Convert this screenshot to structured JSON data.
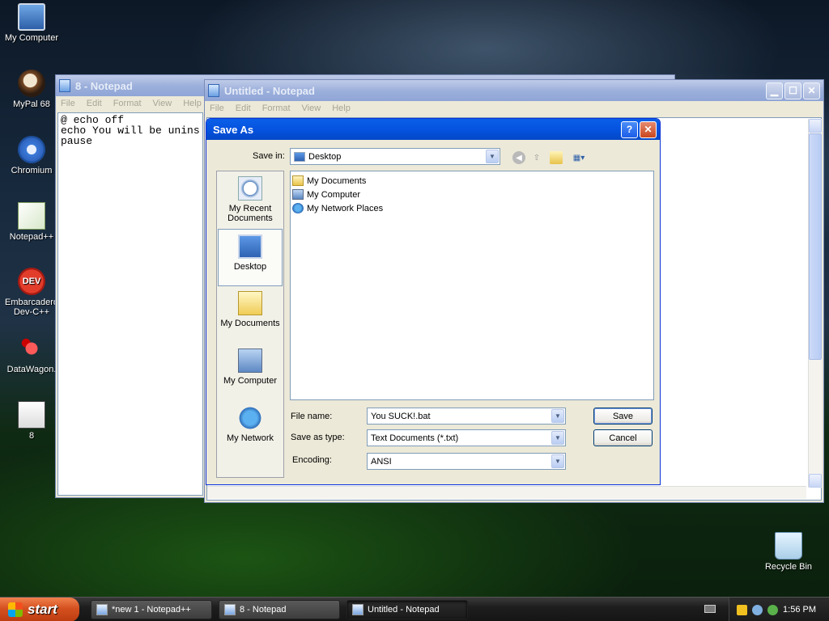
{
  "desktop": {
    "icons": [
      {
        "label": "My Computer"
      },
      {
        "label": "MyPal 68"
      },
      {
        "label": "Chromium"
      },
      {
        "label": "Notepad++"
      },
      {
        "label": "Embarcadero Dev-C++",
        "badge": "DEV"
      },
      {
        "label": "DataWagon."
      },
      {
        "label": "8"
      },
      {
        "label": "Recycle Bin"
      }
    ]
  },
  "notepad_8": {
    "title": "8 - Notepad",
    "menu": [
      "File",
      "Edit",
      "Format",
      "View",
      "Help"
    ],
    "content": "@ echo off\necho You will be unins\npause"
  },
  "notepad_untitled": {
    "title": "Untitled - Notepad",
    "menu": [
      "File",
      "Edit",
      "Format",
      "View",
      "Help"
    ],
    "controls": {
      "minimize": "▁",
      "maximize": "☐",
      "close": "✕"
    }
  },
  "save_dialog": {
    "title": "Save As",
    "help_glyph": "?",
    "close_glyph": "✕",
    "save_in_label": "Save in:",
    "save_in_value": "Desktop",
    "places": [
      "My Recent Documents",
      "Desktop",
      "My Documents",
      "My Computer",
      "My Network"
    ],
    "files": [
      "My Documents",
      "My Computer",
      "My Network Places"
    ],
    "file_name_label": "File name:",
    "file_name_value": "You SUCK!.bat",
    "save_type_label": "Save as type:",
    "save_type_value": "Text Documents (*.txt)",
    "encoding_label": "Encoding:",
    "encoding_value": "ANSI",
    "save_button": "Save",
    "cancel_button": "Cancel"
  },
  "taskbar": {
    "start_label": "start",
    "tasks": [
      "*new 1 - Notepad++",
      "8 - Notepad",
      "Untitled - Notepad"
    ],
    "clock": "1:56 PM"
  }
}
